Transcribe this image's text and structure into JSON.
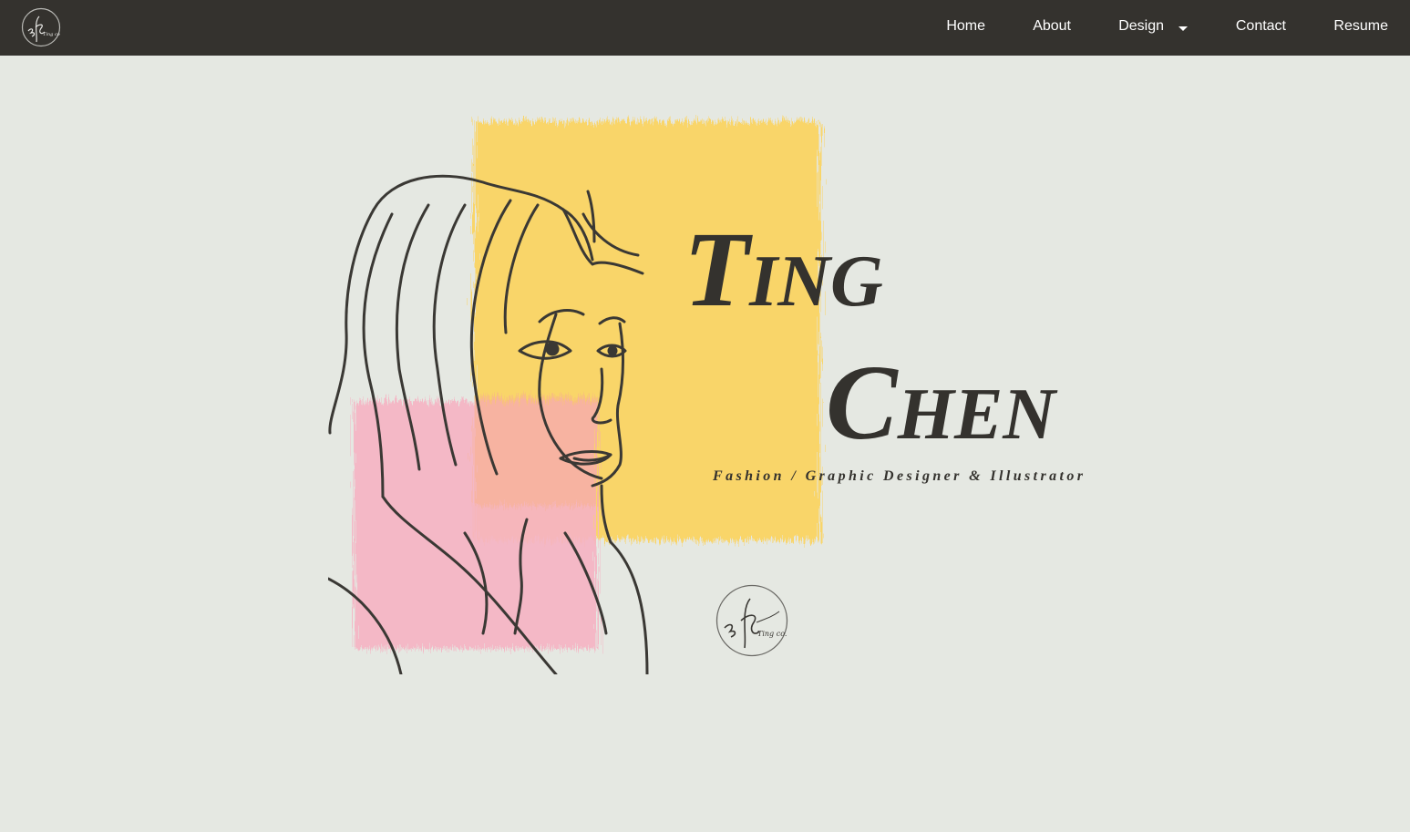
{
  "nav": {
    "logo_icon": "signature-logo-icon",
    "items": [
      {
        "label": "Home"
      },
      {
        "label": "About"
      },
      {
        "label": "Design",
        "has_dropdown": true
      },
      {
        "label": "Contact"
      },
      {
        "label": "Resume"
      }
    ]
  },
  "hero": {
    "first_initial": "T",
    "first_rest": "ING",
    "last_initial": "C",
    "last_rest": "HEN",
    "tagline": "Fashion / Graphic Designer & Illustrator",
    "illustration_icon": "portrait-line-drawing",
    "logo_icon": "signature-logo-icon"
  },
  "colors": {
    "navbar_bg": "#34322e",
    "page_bg": "#e5e8e2",
    "accent_yellow": "#fbd563",
    "accent_pink": "#f6b3c4",
    "text_dark": "#34322e"
  }
}
